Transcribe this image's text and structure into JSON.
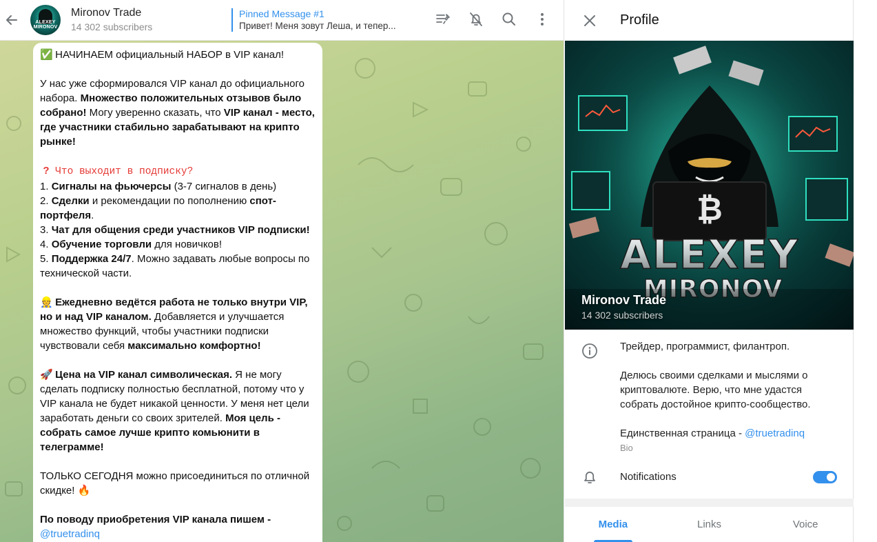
{
  "header": {
    "title": "Mironov Trade",
    "subscribers": "14 302 subscribers",
    "avatar_text": "ALEXEY MIRONOV",
    "pinned_title": "Pinned Message #1",
    "pinned_text": "Привет! Меня зовут Леша, и тепер..."
  },
  "message": {
    "l1": "НАЧИНАЕМ официальный НАБОР в VIP канал!",
    "p1a": "У нас уже сформировался VIP канал до официального набора. ",
    "p1b": "Множество положительных отзывов было собрано!",
    "p1c": " Могу уверенно сказать, что ",
    "p1d": "VIP канал - место, где участники стабильно зарабатывают на крипто рынке!",
    "q_title": "Что выходит в подписку?",
    "i1a": "1. ",
    "i1b": "Сигналы на фьючерсы",
    "i1c": " (3-7 сигналов в день)",
    "i2a": "2. ",
    "i2b": "Сделки",
    "i2c": " и рекомендации по пополнению ",
    "i2d": "спот-портфеля",
    "i2e": ".",
    "i3a": "3. ",
    "i3b": "Чат для общения среди участников VIP подписки!",
    "i4a": "4. ",
    "i4b": "Обучение торговли",
    "i4c": " для новичков!",
    "i5a": "5. ",
    "i5b": "Поддержка 24/7",
    "i5c": ". Можно задавать любые вопросы по технической части.",
    "w1": "Ежедневно ведётся работа не только внутри VIP, но и над VIP каналом.",
    "w2": " Добавляется и улучшается множество функций, чтобы участники подписки чувствовали себя ",
    "w3": "максимально комфортно!",
    "r1": "Цена на VIP канал символическая.",
    "r2": " Я не могу сделать подписку полностью бесплатной, потому что у VIP канала не будет никакой ценности. У меня нет цели заработать деньги со своих зрителей. ",
    "r3": "Моя цель - собрать самое лучше крипто комьюнити в телеграмме!",
    "t1": "ТОЛЬКО СЕГОДНЯ можно присоединиться по отличной скидке! ",
    "c1": "По поводу приобретения VIP канала пишем -",
    "c2": "@truetradinq"
  },
  "profile": {
    "title": "Profile",
    "name": "Mironov Trade",
    "subscribers": "14 302 subscribers",
    "cover_line1": "ALEXEY",
    "cover_line2": "MIRONOV",
    "bio_1": "Трейдер, программист, филантроп.",
    "bio_2": "Делюсь своими сделками и мыслями о криптовалюте. Верю, что мне удастся собрать достойное крипто-сообщество.",
    "bio_3a": "Единственная страница - ",
    "bio_3b": "@truetradinq",
    "bio_label": "Bio",
    "notifications": "Notifications",
    "notifications_on": true
  },
  "tabs": [
    {
      "label": "Media",
      "active": true
    },
    {
      "label": "Links",
      "active": false
    },
    {
      "label": "Voice",
      "active": false
    }
  ],
  "colors": {
    "accent": "#3390ec",
    "bubble": "#ffffff",
    "wallpaper_top": "#cfd79a",
    "wallpaper_bottom": "#86ad82"
  },
  "icons": [
    "back-arrow-icon",
    "pinned-list-icon",
    "mute-bell-icon",
    "search-icon",
    "more-vertical-icon",
    "close-icon",
    "info-icon",
    "bell-icon"
  ]
}
